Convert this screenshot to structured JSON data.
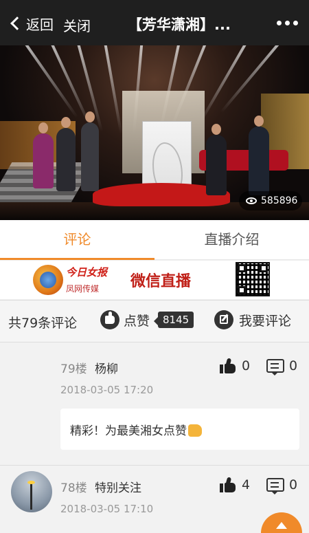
{
  "nav": {
    "back_label": "返回",
    "close_label": "关闭",
    "title": "【芳华潇湘】..."
  },
  "video": {
    "view_count": "585896"
  },
  "tabs": [
    {
      "label": "评论",
      "active": true
    },
    {
      "label": "直播介绍",
      "active": false
    }
  ],
  "banner": {
    "paper_name": "今日女报",
    "media_name": "凤网传媒",
    "title": "微信直播"
  },
  "actions": {
    "comment_count": "共79条评论",
    "like_label": "点赞",
    "like_count": "8145",
    "write_label": "我要评论"
  },
  "comments": [
    {
      "floor": "79楼",
      "user": "杨柳",
      "time": "2018-03-05 17:20",
      "likes": "0",
      "replies": "0",
      "text": "精彩！为最美湘女点赞"
    },
    {
      "floor": "78楼",
      "user": "特别关注",
      "time": "2018-03-05 17:10",
      "likes": "4",
      "replies": "0"
    }
  ],
  "colors": {
    "accent": "#f08a2a",
    "nav_bg": "#1f1f1f"
  }
}
